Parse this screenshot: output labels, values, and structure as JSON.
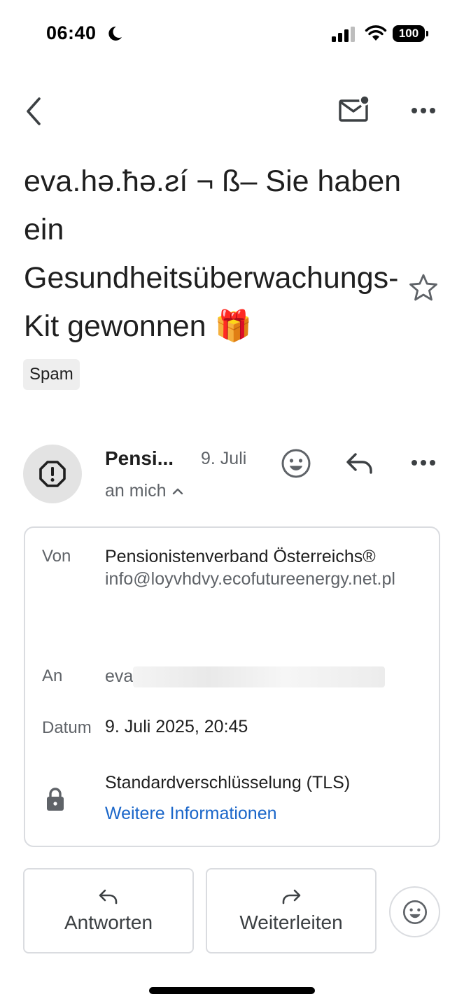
{
  "status_bar": {
    "time": "06:40",
    "battery": "100"
  },
  "email": {
    "subject": "eva.hə.ħə.ƨí ¬ ß– Sie haben ein Gesundheitsüberwachungs-Kit gewonnen 🎁",
    "label": "Spam"
  },
  "sender": {
    "short_name": "Pensi...",
    "date": "9. Juli",
    "recipient_toggle": "an mich"
  },
  "details": {
    "from_label": "Von",
    "from_name": "Pensionistenverband Österreichs®",
    "from_email": "info@loyvhdvy.ecofutureenergy.net.pl",
    "to_label": "An",
    "to_value": "eva",
    "date_label": "Datum",
    "date_value": "9. Juli 2025, 20:45",
    "encryption": "Standardverschlüsselung (TLS)",
    "more_info": "Weitere Informationen"
  },
  "actions": {
    "reply": "Antworten",
    "forward": "Weiterleiten"
  },
  "icons": {
    "back": "chevron-left-icon",
    "mark_unread": "mail-unread-icon",
    "more": "more-horizontal-icon",
    "star": "star-outline-icon",
    "avatar": "warning-octagon-icon",
    "emoji": "emoji-smile-icon",
    "reply": "reply-icon",
    "lock": "lock-icon",
    "forward": "forward-icon"
  }
}
